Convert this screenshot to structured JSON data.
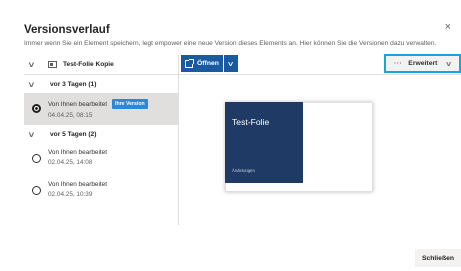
{
  "dialog": {
    "title": "Versionsverlauf",
    "subtitle": "Immer wenn Sie ein Element speichern, legt empower eine neue Version dieses Elements an. Hier können Sie die Versionen dazu verwalten.",
    "close_icon": "×"
  },
  "file": {
    "name": "Test-Folie Kopie",
    "icon": "presentation-icon"
  },
  "groups": [
    {
      "label": "vor 3 Tagen (1)",
      "versions": [
        {
          "author": "Von Ihnen bearbeitet",
          "timestamp": "04.04.25, 08:15",
          "badge": "Ihre Version",
          "selected": true
        }
      ]
    },
    {
      "label": "vor 5 Tagen (2)",
      "versions": [
        {
          "author": "Von Ihnen bearbeitet",
          "timestamp": "02.04.25, 14:08",
          "selected": false
        },
        {
          "author": "Von Ihnen bearbeitet",
          "timestamp": "02.04.25, 10:39",
          "selected": false
        }
      ]
    }
  ],
  "toolbar": {
    "open_label": "Öffnen",
    "more_dots": "···",
    "more_label": "Erweitert"
  },
  "preview": {
    "slide_title": "Test-Folie",
    "slide_subtitle": "Änderungen"
  },
  "footer": {
    "close_label": "Schließen"
  },
  "colors": {
    "accent": "#1a5aa0",
    "highlight_border": "#16a6d9",
    "badge": "#2b88d8",
    "slide_title_bg": "#1f3a64"
  }
}
